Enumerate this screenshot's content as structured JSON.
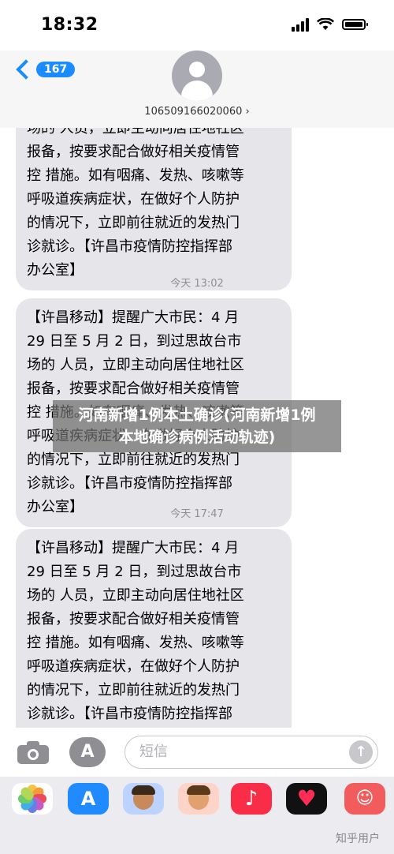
{
  "status": {
    "time": "18:32"
  },
  "header": {
    "back_count": "167",
    "sender": "106509166020060 ›"
  },
  "messages": [
    {
      "text": "场的 人员，立即主动向居住地社区\n报备，按要求配合做好相关疫情管\n控 措施。如有咽痛、发热、咳嗽等\n呼吸道疾病症状，在做好个人防护\n的情况下，立即前往就近的发热门\n诊就诊。【许昌市疫情防控指挥部\n办公室】"
    },
    {
      "timestamp": "今天 13:02",
      "text": "【许昌移动】提醒广大市民：4 月\n29 日至 5 月 2 日，到过思故台市\n场的 人员，立即主动向居住地社区\n报备，按要求配合做好相关疫情管\n控 措施。如有咽痛、发热、咳嗽等\n呼吸道疾病症状，在做好个人防护\n的情况下，立即前往就近的发热门\n诊就诊。【许昌市疫情防控指挥部\n办公室】"
    },
    {
      "timestamp": "今天 17:47",
      "text": "【许昌移动】提醒广大市民：4 月\n29 日至 5 月 2 日，到过思故台市\n场的 人员，立即主动向居住地社区\n报备，按要求配合做好相关疫情管\n控 措施。如有咽痛、发热、咳嗽等\n呼吸道疾病症状，在做好个人防护\n的情况下，立即前往就近的发热门\n诊就诊。【许昌市疫情防控指挥部\n办公室】"
    }
  ],
  "banner": {
    "line1": "河南新增1例本土确诊(河南新增1例",
    "line2": "本地确诊病例活动轨迹)"
  },
  "input": {
    "placeholder": "短信"
  },
  "watermark": "知乎用户",
  "colors": {
    "accent": "#1a8cff",
    "bubble": "#e5e5ea"
  }
}
